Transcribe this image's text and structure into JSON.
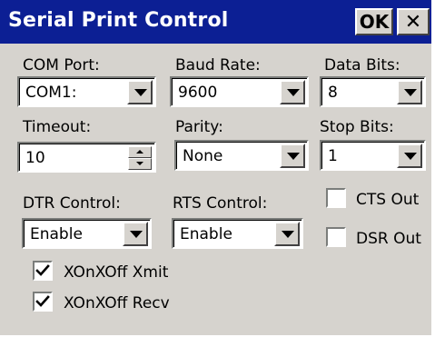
{
  "window": {
    "title": "Serial Print Control"
  },
  "titlebar": {
    "ok_label": "OK",
    "close_label": "✕"
  },
  "com_port": {
    "label": "COM Port:",
    "value": "COM1:"
  },
  "baud_rate": {
    "label": "Baud Rate:",
    "value": "9600"
  },
  "data_bits": {
    "label": "Data Bits:",
    "value": "8"
  },
  "timeout": {
    "label": "Timeout:",
    "value": "10"
  },
  "parity": {
    "label": "Parity:",
    "value": "None"
  },
  "stop_bits": {
    "label": "Stop Bits:",
    "value": "1"
  },
  "dtr_control": {
    "label": "DTR Control:",
    "value": "Enable"
  },
  "rts_control": {
    "label": "RTS Control:",
    "value": "Enable"
  },
  "cts_out": {
    "label": "CTS Out",
    "checked": false
  },
  "dsr_out": {
    "label": "DSR Out",
    "checked": false
  },
  "xon_xmit": {
    "label": "XOnXOff Xmit",
    "checked": true
  },
  "xon_recv": {
    "label": "XOnXOff Recv",
    "checked": true
  }
}
